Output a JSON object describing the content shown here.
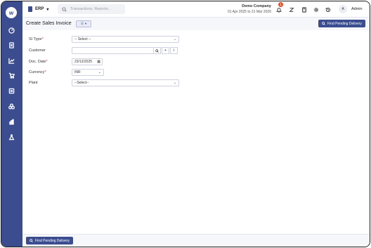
{
  "topbar": {
    "module": "ERP",
    "search_placeholder": "Transactions, Reports...",
    "company_name": "Demo Company",
    "fiscal_range": "01 Apr 2025 to 31 Mar 2026",
    "notification_count": "1",
    "avatar_initial": "A",
    "user_name": "Admin"
  },
  "header": {
    "title": "Create Sales Invoice",
    "find_pending_label": "Find Pending Delivery"
  },
  "form": {
    "si_type": {
      "label": "SI Type",
      "value": "-- Select --"
    },
    "customer": {
      "label": "Customer",
      "value": ""
    },
    "doc_date": {
      "label": "Doc. Date",
      "value": "23/12/2025"
    },
    "currency": {
      "label": "Currency",
      "value": "INR"
    },
    "plant": {
      "label": "Plant",
      "value": "--Select--"
    }
  },
  "footer": {
    "find_pending_label": "Find Pending Delivery"
  },
  "colors": {
    "sidebar": "#3b4d8f",
    "primary": "#3b4d8f",
    "required": "#d0342c",
    "badge": "#e0502e"
  }
}
